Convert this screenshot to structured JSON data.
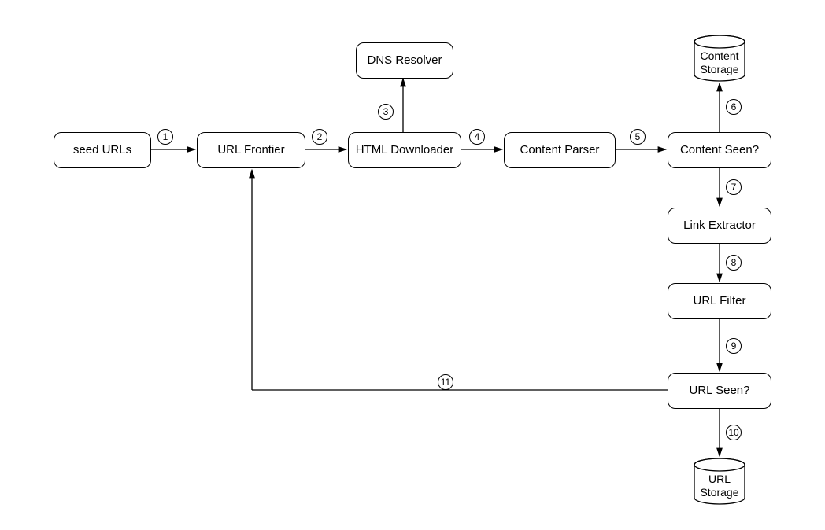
{
  "diagram": {
    "type": "web-crawler-architecture",
    "nodes": {
      "seed_urls": "seed URLs",
      "url_frontier": "URL Frontier",
      "html_downloader": "HTML Downloader",
      "dns_resolver": "DNS Resolver",
      "content_parser": "Content Parser",
      "content_seen": "Content Seen?",
      "link_extractor": "Link Extractor",
      "url_filter": "URL Filter",
      "url_seen": "URL Seen?",
      "content_storage": "Content\nStorage",
      "url_storage": "URL\nStorage"
    },
    "edges": {
      "e1": "1",
      "e2": "2",
      "e3": "3",
      "e4": "4",
      "e5": "5",
      "e6": "6",
      "e7": "7",
      "e8": "8",
      "e9": "9",
      "e10": "10",
      "e11": "11"
    },
    "flow": [
      {
        "from": "seed_urls",
        "to": "url_frontier",
        "label": "1"
      },
      {
        "from": "url_frontier",
        "to": "html_downloader",
        "label": "2"
      },
      {
        "from": "html_downloader",
        "to": "dns_resolver",
        "label": "3",
        "bidirectional": false
      },
      {
        "from": "html_downloader",
        "to": "content_parser",
        "label": "4"
      },
      {
        "from": "content_parser",
        "to": "content_seen",
        "label": "5"
      },
      {
        "from": "content_seen",
        "to": "content_storage",
        "label": "6",
        "bidirectional": true
      },
      {
        "from": "content_seen",
        "to": "link_extractor",
        "label": "7"
      },
      {
        "from": "link_extractor",
        "to": "url_filter",
        "label": "8"
      },
      {
        "from": "url_filter",
        "to": "url_seen",
        "label": "9"
      },
      {
        "from": "url_seen",
        "to": "url_storage",
        "label": "10",
        "bidirectional": true
      },
      {
        "from": "url_seen",
        "to": "url_frontier",
        "label": "11"
      }
    ]
  }
}
